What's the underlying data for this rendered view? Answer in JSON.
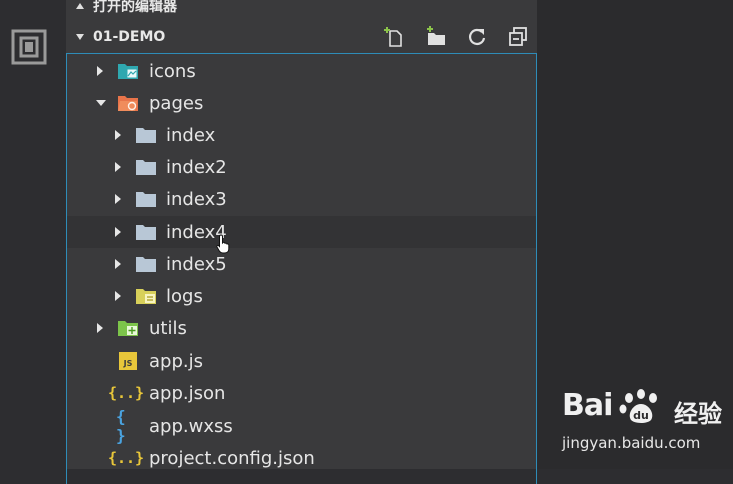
{
  "activity_bar": {
    "icon": "files-icon"
  },
  "explorer": {
    "open_editors_header": "打开的编辑器",
    "project_header": "01-DEMO",
    "toolbar": [
      {
        "name": "new-file-button",
        "icon": "new-file-icon"
      },
      {
        "name": "new-folder-button",
        "icon": "new-folder-icon"
      },
      {
        "name": "refresh-button",
        "icon": "refresh-icon"
      },
      {
        "name": "collapse-all-button",
        "icon": "collapse-all-icon"
      }
    ],
    "tree": [
      {
        "label": "icons",
        "icon": "images-folder-icon",
        "twisty": "right"
      },
      {
        "label": "pages",
        "icon": "pages-folder-icon",
        "twisty": "down"
      },
      {
        "label": "index",
        "icon": "folder-icon",
        "twisty": "right"
      },
      {
        "label": "index2",
        "icon": "folder-icon",
        "twisty": "right"
      },
      {
        "label": "index3",
        "icon": "folder-icon",
        "twisty": "right"
      },
      {
        "label": "index4",
        "icon": "folder-icon",
        "twisty": "right",
        "hovered": true
      },
      {
        "label": "index5",
        "icon": "folder-icon",
        "twisty": "right"
      },
      {
        "label": "logs",
        "icon": "logs-folder-icon",
        "twisty": "right"
      },
      {
        "label": "utils",
        "icon": "utils-folder-icon",
        "twisty": "right"
      },
      {
        "label": "app.js",
        "icon": "js-file-icon",
        "badge": "JS"
      },
      {
        "label": "app.json",
        "icon": "json-file-icon",
        "badge": "{..}"
      },
      {
        "label": "app.wxss",
        "icon": "wxss-file-icon",
        "badge": "{ }"
      },
      {
        "label": "project.config.json",
        "icon": "json-file-icon",
        "badge": "{..}"
      }
    ]
  },
  "colors": {
    "selection_border": "#2e8cb8",
    "folder_gray": "#b8c7d6",
    "js_yellow": "#e8c63a",
    "json_yellow": "#e8c63a",
    "wxss_blue": "#4aa3e0"
  },
  "watermark": {
    "logo_text": "Bai",
    "logo_suffix": "经验",
    "url": "jingyan.baidu.com"
  }
}
